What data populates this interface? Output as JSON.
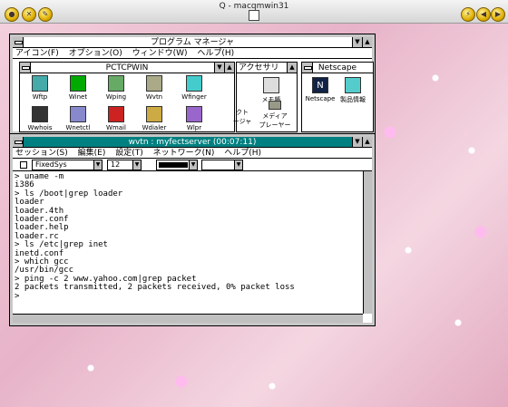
{
  "titlebar": {
    "title": "Q - macqmwin31"
  },
  "progman": {
    "title": "プログラム マネージャ",
    "menu": [
      "アイコン(F)",
      "オプション(O)",
      "ウィンドウ(W)",
      "ヘルプ(H)"
    ]
  },
  "pctcpwin": {
    "title": "PCTCPWIN",
    "icons": [
      "Wftp",
      "Winet",
      "Wping",
      "Wvtn",
      "Wfinger",
      "Wwhois",
      "Wnetctl",
      "Wmail",
      "Wdialer",
      "Wlpr"
    ]
  },
  "accessories": {
    "title": "アクセサリ",
    "icons": [
      "メモ帳",
      "クト\nージャ",
      "メディア\nプレーヤー"
    ]
  },
  "netscape": {
    "title": "Netscape",
    "icons": [
      "Netscape",
      "製品情報"
    ]
  },
  "terminal": {
    "title": "wvtn : myfectserver (00:07:11)",
    "menu": [
      "セッション(S)",
      "編集(E)",
      "設定(T)",
      "ネットワーク(N)",
      "ヘルプ(H)"
    ],
    "font": "FixedSys",
    "size": "12",
    "lines": [
      "> uname -m",
      "i386",
      "> ls /boot|grep loader",
      "loader",
      "loader.4th",
      "loader.conf",
      "loader.help",
      "loader.rc",
      "> ls /etc|grep inet",
      "inetd.conf",
      "> which gcc",
      "/usr/bin/gcc",
      "> ping -c 2 www.yahoo.com|grep packet",
      "2 packets transmitted, 2 packets received, 0% packet loss",
      ">"
    ]
  }
}
